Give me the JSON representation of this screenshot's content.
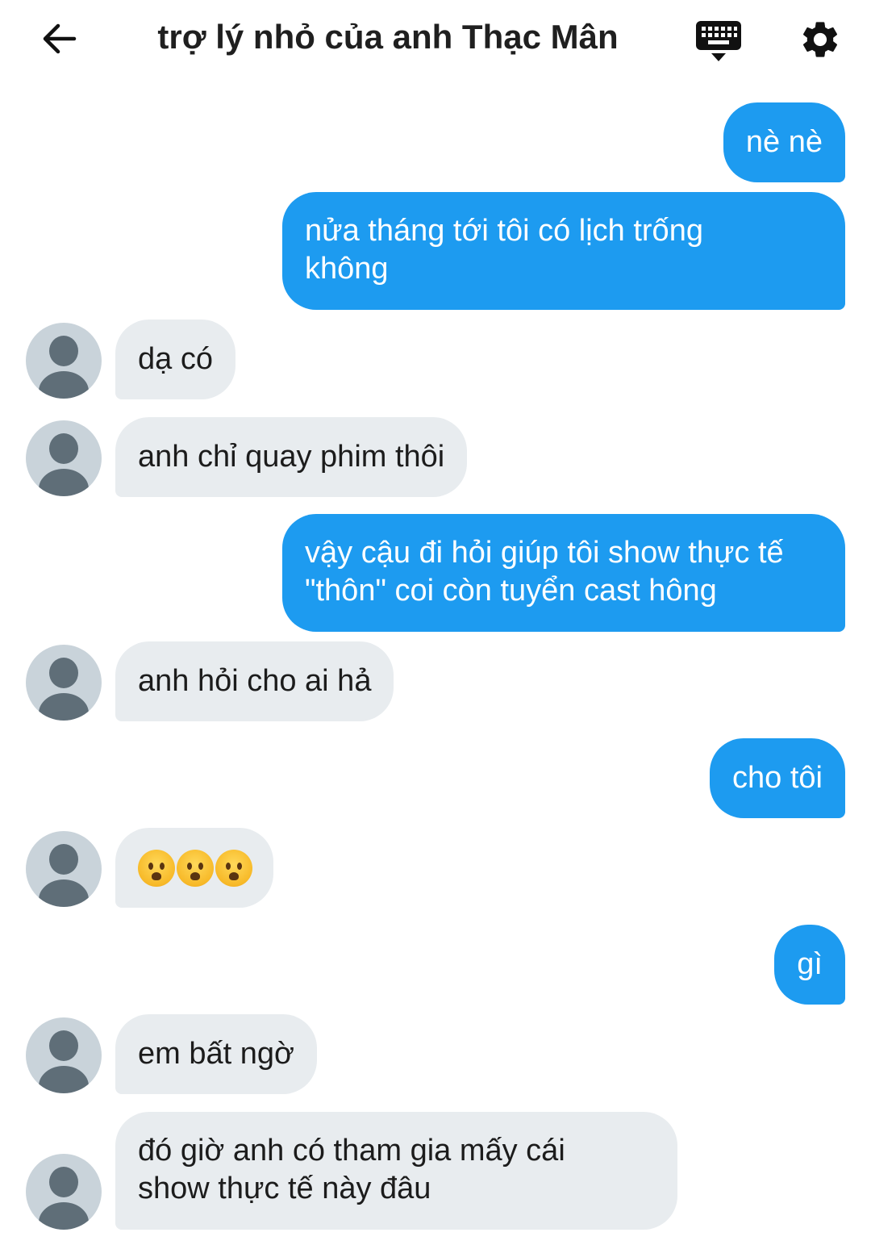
{
  "header": {
    "title": "trợ lý nhỏ của anh Thạc Mân",
    "back_icon": "back-arrow-icon",
    "keyboard_icon": "keyboard-icon",
    "settings_icon": "gear-icon"
  },
  "colors": {
    "outgoing_bubble": "#1d9bf0",
    "incoming_bubble": "#e8ecef",
    "avatar_bg": "#c9d3da"
  },
  "messages": [
    {
      "from": "me",
      "text": "nè nè"
    },
    {
      "from": "me",
      "text": "nửa tháng tới tôi có lịch trống\nkhông"
    },
    {
      "from": "them",
      "text": "dạ có"
    },
    {
      "from": "them",
      "text": "anh chỉ quay phim thôi"
    },
    {
      "from": "me",
      "text": "vậy cậu đi hỏi giúp tôi show thực tế\n\"thôn\" coi còn tuyển cast hông"
    },
    {
      "from": "them",
      "text": "anh hỏi cho ai hả"
    },
    {
      "from": "me",
      "text": "cho tôi"
    },
    {
      "from": "them",
      "text": "",
      "emoji": [
        "anguished-face-icon",
        "anguished-face-icon",
        "anguished-face-icon"
      ]
    },
    {
      "from": "me",
      "text": "gì"
    },
    {
      "from": "them",
      "text": "em bất ngờ"
    },
    {
      "from": "them",
      "text": "đó giờ anh có tham gia mấy cái\nshow thực tế này đâu"
    }
  ]
}
